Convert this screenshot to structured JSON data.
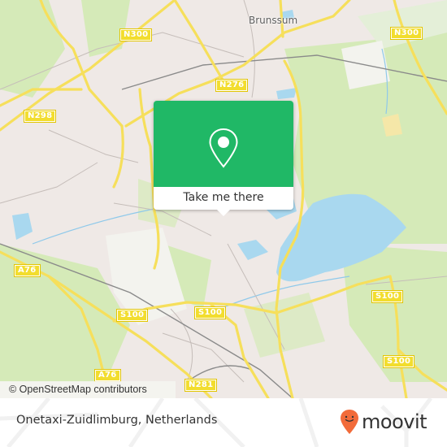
{
  "map": {
    "place_labels": [
      {
        "id": "brunssum",
        "text": "Brunssum"
      }
    ],
    "road_labels": [
      {
        "id": "n300-left",
        "text": "N300"
      },
      {
        "id": "n300-right",
        "text": "N300"
      },
      {
        "id": "n298",
        "text": "N298"
      },
      {
        "id": "n276",
        "text": "N276"
      },
      {
        "id": "a76-top",
        "text": "A76"
      },
      {
        "id": "a76-bottom",
        "text": "A76"
      },
      {
        "id": "s100-left",
        "text": "S100"
      },
      {
        "id": "s100-mid",
        "text": "S100"
      },
      {
        "id": "s100-right",
        "text": "S100"
      },
      {
        "id": "s100-bottom",
        "text": "S100"
      },
      {
        "id": "n281",
        "text": "N281"
      }
    ],
    "attribution": "© OpenStreetMap contributors",
    "colors": {
      "land": "#efe9e6",
      "green": "#d5eab8",
      "water": "#a9d8ef",
      "road": "#f6df5b",
      "accent": "#20b866"
    }
  },
  "popup": {
    "icon": "map-pin-icon",
    "button_label": "Take me there"
  },
  "footer": {
    "place_name": "Onetaxi-Zuidlimburg, Netherlands",
    "brand": "moovit",
    "brand_color": "#f26b3a"
  }
}
